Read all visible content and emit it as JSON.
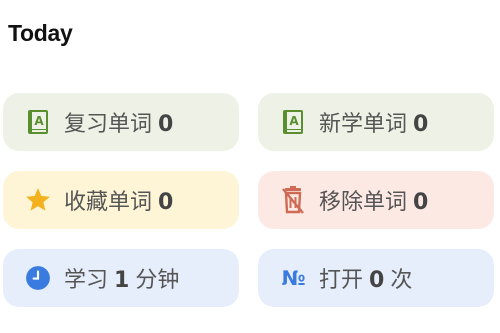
{
  "header": {
    "title": "Today"
  },
  "cards": {
    "review_words": {
      "label": "复习单词",
      "count": "0",
      "icon": "book-icon",
      "bg": "#eef2e6",
      "icon_color": "#5a8f2f"
    },
    "new_words": {
      "label": "新学单词",
      "count": "0",
      "icon": "book-icon",
      "bg": "#eef2e6",
      "icon_color": "#5a8f2f"
    },
    "favorite_words": {
      "label": "收藏单词",
      "count": "0",
      "icon": "star-icon",
      "bg": "#fdf5d6",
      "icon_color": "#f2b11d"
    },
    "removed_words": {
      "label": "移除单词",
      "count": "0",
      "icon": "trash-off-icon",
      "bg": "#fde9e4",
      "icon_color": "#cf6b55"
    },
    "study_time": {
      "prefix": "学习",
      "count": "1",
      "suffix": "分钟",
      "icon": "clock-icon",
      "bg": "#e7eefb",
      "icon_color": "#3a7be0"
    },
    "opened": {
      "numero": "№",
      "prefix": "打开",
      "count": "0",
      "suffix": "次",
      "bg": "#e7eefb",
      "icon_color": "#3a7be0"
    }
  }
}
